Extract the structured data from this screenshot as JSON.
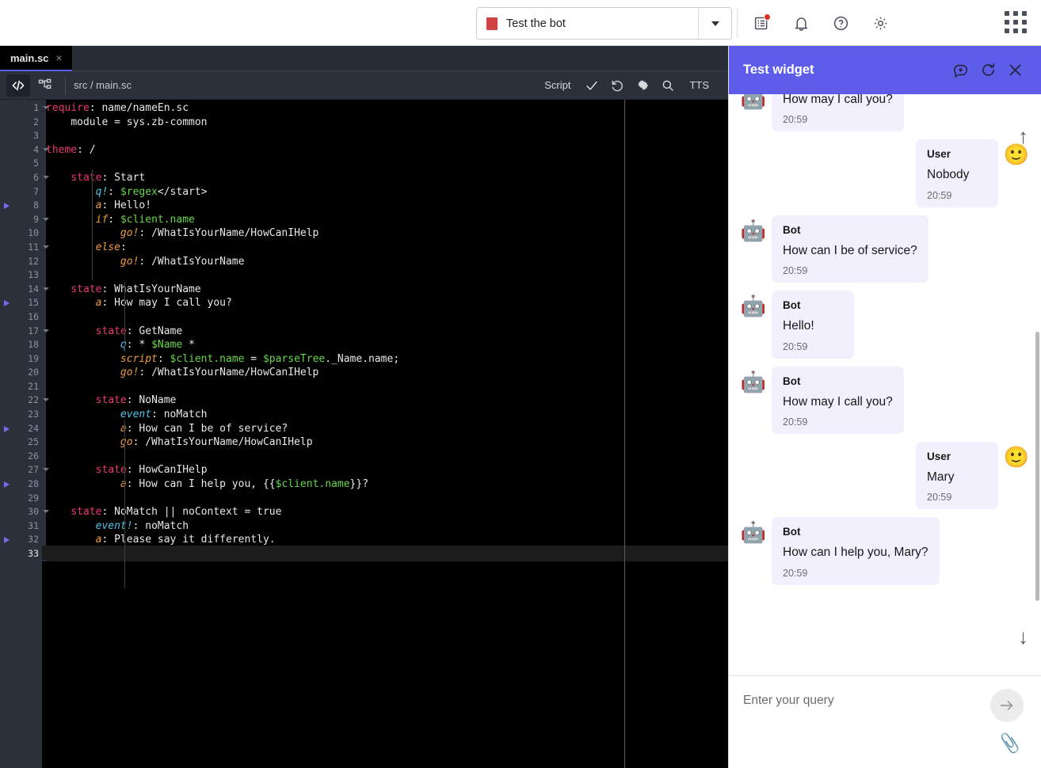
{
  "topbar": {
    "bot_selector": {
      "label": "Test the bot",
      "chip_color": "#cf4343",
      "caret": "chevron-down-icon"
    },
    "icons": [
      {
        "name": "release-notes-icon",
        "glyph": "notes",
        "badge": true
      },
      {
        "name": "notifications-bell-icon",
        "glyph": "bell",
        "badge": false
      },
      {
        "name": "help-icon",
        "glyph": "question",
        "badge": false
      },
      {
        "name": "settings-gear-icon",
        "glyph": "gear",
        "badge": false
      }
    ],
    "apps_label": "apps-grid-icon"
  },
  "editor": {
    "tab": {
      "label": "main.sc",
      "close": "×"
    },
    "toolbar": {
      "code_view_icon": "code-brackets-icon",
      "graph_view_icon": "flow-tree-icon",
      "path": "src / main.sc",
      "mode_label": "Script",
      "validate_icon": "checkmark-icon",
      "revert_icon": "undo-icon",
      "settings_icon": "gear-icon",
      "search_icon": "magnifier-icon",
      "tts_label": "TTS"
    },
    "accent": "#5d5df0",
    "lines": [
      {
        "n": 1,
        "fold": true,
        "bp": false,
        "tokens": [
          {
            "c": "t-kw",
            "t": "require"
          },
          {
            "c": "t-punc",
            "t": ": "
          },
          {
            "c": "t-str",
            "t": "name/nameEn.sc"
          }
        ]
      },
      {
        "n": 2,
        "fold": false,
        "bp": false,
        "tokens": [
          {
            "c": "t-punc",
            "t": "    "
          },
          {
            "c": "t-str",
            "t": "module = sys.zb-common"
          }
        ]
      },
      {
        "n": 3,
        "fold": false,
        "bp": false,
        "tokens": []
      },
      {
        "n": 4,
        "fold": true,
        "bp": false,
        "tokens": [
          {
            "c": "t-kw",
            "t": "theme"
          },
          {
            "c": "t-punc",
            "t": ": "
          },
          {
            "c": "t-str",
            "t": "/"
          }
        ]
      },
      {
        "n": 5,
        "fold": false,
        "bp": false,
        "tokens": []
      },
      {
        "n": 6,
        "fold": true,
        "bp": false,
        "tokens": [
          {
            "c": "t-punc",
            "t": "    "
          },
          {
            "c": "t-kw",
            "t": "state"
          },
          {
            "c": "t-punc",
            "t": ": "
          },
          {
            "c": "t-str",
            "t": "Start"
          }
        ]
      },
      {
        "n": 7,
        "fold": false,
        "bp": false,
        "tokens": [
          {
            "c": "t-punc",
            "t": "        "
          },
          {
            "c": "t-attr2",
            "t": "q!"
          },
          {
            "c": "t-punc",
            "t": ": "
          },
          {
            "c": "t-var",
            "t": "$regex"
          },
          {
            "c": "t-str",
            "t": "</start>"
          }
        ]
      },
      {
        "n": 8,
        "fold": false,
        "bp": true,
        "tokens": [
          {
            "c": "t-punc",
            "t": "        "
          },
          {
            "c": "t-attr",
            "t": "a"
          },
          {
            "c": "t-punc",
            "t": ": "
          },
          {
            "c": "t-str",
            "t": "Hello!"
          }
        ]
      },
      {
        "n": 9,
        "fold": true,
        "bp": false,
        "tokens": [
          {
            "c": "t-punc",
            "t": "        "
          },
          {
            "c": "t-attr",
            "t": "if"
          },
          {
            "c": "t-punc",
            "t": ": "
          },
          {
            "c": "t-var",
            "t": "$client.name"
          }
        ]
      },
      {
        "n": 10,
        "fold": false,
        "bp": false,
        "tokens": [
          {
            "c": "t-punc",
            "t": "            "
          },
          {
            "c": "t-attr",
            "t": "go!"
          },
          {
            "c": "t-punc",
            "t": ": "
          },
          {
            "c": "t-str",
            "t": "/WhatIsYourName/HowCanIHelp"
          }
        ]
      },
      {
        "n": 11,
        "fold": true,
        "bp": false,
        "tokens": [
          {
            "c": "t-punc",
            "t": "        "
          },
          {
            "c": "t-attr",
            "t": "else"
          },
          {
            "c": "t-punc",
            "t": ":"
          }
        ]
      },
      {
        "n": 12,
        "fold": false,
        "bp": false,
        "tokens": [
          {
            "c": "t-punc",
            "t": "            "
          },
          {
            "c": "t-attr",
            "t": "go!"
          },
          {
            "c": "t-punc",
            "t": ": "
          },
          {
            "c": "t-str",
            "t": "/WhatIsYourName"
          }
        ]
      },
      {
        "n": 13,
        "fold": false,
        "bp": false,
        "tokens": []
      },
      {
        "n": 14,
        "fold": true,
        "bp": false,
        "tokens": [
          {
            "c": "t-punc",
            "t": "    "
          },
          {
            "c": "t-kw",
            "t": "state"
          },
          {
            "c": "t-punc",
            "t": ": "
          },
          {
            "c": "t-str",
            "t": "WhatIsYourName"
          }
        ]
      },
      {
        "n": 15,
        "fold": false,
        "bp": true,
        "tokens": [
          {
            "c": "t-punc",
            "t": "        "
          },
          {
            "c": "t-attr",
            "t": "a"
          },
          {
            "c": "t-punc",
            "t": ": "
          },
          {
            "c": "t-str",
            "t": "How may I call you?"
          }
        ]
      },
      {
        "n": 16,
        "fold": false,
        "bp": false,
        "tokens": []
      },
      {
        "n": 17,
        "fold": true,
        "bp": false,
        "tokens": [
          {
            "c": "t-punc",
            "t": "        "
          },
          {
            "c": "t-kw",
            "t": "state"
          },
          {
            "c": "t-punc",
            "t": ": "
          },
          {
            "c": "t-str",
            "t": "GetName"
          }
        ]
      },
      {
        "n": 18,
        "fold": false,
        "bp": false,
        "tokens": [
          {
            "c": "t-punc",
            "t": "            "
          },
          {
            "c": "t-attr2",
            "t": "q"
          },
          {
            "c": "t-punc",
            "t": ": "
          },
          {
            "c": "t-str",
            "t": "* "
          },
          {
            "c": "t-var",
            "t": "$Name"
          },
          {
            "c": "t-str",
            "t": " *"
          }
        ]
      },
      {
        "n": 19,
        "fold": false,
        "bp": false,
        "tokens": [
          {
            "c": "t-punc",
            "t": "            "
          },
          {
            "c": "t-attr",
            "t": "script"
          },
          {
            "c": "t-punc",
            "t": ": "
          },
          {
            "c": "t-var",
            "t": "$client.name"
          },
          {
            "c": "t-op",
            "t": " = "
          },
          {
            "c": "t-var",
            "t": "$parseTree"
          },
          {
            "c": "t-str",
            "t": "._Name.name;"
          }
        ]
      },
      {
        "n": 20,
        "fold": false,
        "bp": false,
        "tokens": [
          {
            "c": "t-punc",
            "t": "            "
          },
          {
            "c": "t-attr",
            "t": "go!"
          },
          {
            "c": "t-punc",
            "t": ": "
          },
          {
            "c": "t-str",
            "t": "/WhatIsYourName/HowCanIHelp"
          }
        ]
      },
      {
        "n": 21,
        "fold": false,
        "bp": false,
        "tokens": []
      },
      {
        "n": 22,
        "fold": true,
        "bp": false,
        "tokens": [
          {
            "c": "t-punc",
            "t": "        "
          },
          {
            "c": "t-kw",
            "t": "state"
          },
          {
            "c": "t-punc",
            "t": ": "
          },
          {
            "c": "t-str",
            "t": "NoName"
          }
        ]
      },
      {
        "n": 23,
        "fold": false,
        "bp": false,
        "tokens": [
          {
            "c": "t-punc",
            "t": "            "
          },
          {
            "c": "t-attr2",
            "t": "event"
          },
          {
            "c": "t-punc",
            "t": ": "
          },
          {
            "c": "t-str",
            "t": "noMatch"
          }
        ]
      },
      {
        "n": 24,
        "fold": false,
        "bp": true,
        "tokens": [
          {
            "c": "t-punc",
            "t": "            "
          },
          {
            "c": "t-attr",
            "t": "a"
          },
          {
            "c": "t-punc",
            "t": ": "
          },
          {
            "c": "t-str",
            "t": "How can I be of service?"
          }
        ]
      },
      {
        "n": 25,
        "fold": false,
        "bp": false,
        "tokens": [
          {
            "c": "t-punc",
            "t": "            "
          },
          {
            "c": "t-attr",
            "t": "go"
          },
          {
            "c": "t-punc",
            "t": ": "
          },
          {
            "c": "t-str",
            "t": "/WhatIsYourName/HowCanIHelp"
          }
        ]
      },
      {
        "n": 26,
        "fold": false,
        "bp": false,
        "tokens": []
      },
      {
        "n": 27,
        "fold": true,
        "bp": false,
        "tokens": [
          {
            "c": "t-punc",
            "t": "        "
          },
          {
            "c": "t-kw",
            "t": "state"
          },
          {
            "c": "t-punc",
            "t": ": "
          },
          {
            "c": "t-str",
            "t": "HowCanIHelp"
          }
        ]
      },
      {
        "n": 28,
        "fold": false,
        "bp": true,
        "tokens": [
          {
            "c": "t-punc",
            "t": "            "
          },
          {
            "c": "t-attr",
            "t": "a"
          },
          {
            "c": "t-punc",
            "t": ": "
          },
          {
            "c": "t-str",
            "t": "How can I help you, "
          },
          {
            "c": "t-punc",
            "t": "{{"
          },
          {
            "c": "t-var",
            "t": "$client.name"
          },
          {
            "c": "t-punc",
            "t": "}}"
          },
          {
            "c": "t-str",
            "t": "?"
          }
        ]
      },
      {
        "n": 29,
        "fold": false,
        "bp": false,
        "tokens": []
      },
      {
        "n": 30,
        "fold": true,
        "bp": false,
        "tokens": [
          {
            "c": "t-punc",
            "t": "    "
          },
          {
            "c": "t-kw",
            "t": "state"
          },
          {
            "c": "t-punc",
            "t": ": "
          },
          {
            "c": "t-str",
            "t": "NoMatch "
          },
          {
            "c": "t-punc",
            "t": "|| "
          },
          {
            "c": "t-str",
            "t": "noContext = true"
          }
        ]
      },
      {
        "n": 31,
        "fold": false,
        "bp": false,
        "tokens": [
          {
            "c": "t-punc",
            "t": "        "
          },
          {
            "c": "t-attr2",
            "t": "event!"
          },
          {
            "c": "t-punc",
            "t": ": "
          },
          {
            "c": "t-str",
            "t": "noMatch"
          }
        ]
      },
      {
        "n": 32,
        "fold": false,
        "bp": true,
        "tokens": [
          {
            "c": "t-punc",
            "t": "        "
          },
          {
            "c": "t-attr",
            "t": "a"
          },
          {
            "c": "t-punc",
            "t": ": "
          },
          {
            "c": "t-str",
            "t": "Please say it differently."
          }
        ]
      },
      {
        "n": 33,
        "fold": false,
        "bp": false,
        "cur": true,
        "tokens": []
      }
    ]
  },
  "widget": {
    "title": "Test widget",
    "header_buttons": [
      {
        "name": "new-chat-icon"
      },
      {
        "name": "reload-icon"
      },
      {
        "name": "close-icon"
      }
    ],
    "accent": "#5d5dea",
    "scroll_up_icon": "arrow-up-icon",
    "scroll_down_icon": "arrow-down-icon",
    "messages": [
      {
        "side": "bot",
        "author": "",
        "text": "How may I call you?",
        "time": "20:59",
        "avatar": "🤖",
        "clipped": true
      },
      {
        "side": "user",
        "author": "User",
        "text": "Nobody",
        "time": "20:59",
        "avatar": "🙂"
      },
      {
        "side": "bot",
        "author": "Bot",
        "text": "How can I be of service?",
        "time": "20:59",
        "avatar": "🤖"
      },
      {
        "side": "bot",
        "author": "Bot",
        "text": "Hello!",
        "time": "20:59",
        "avatar": "🤖"
      },
      {
        "side": "bot",
        "author": "Bot",
        "text": "How may I call you?",
        "time": "20:59",
        "avatar": "🤖"
      },
      {
        "side": "user",
        "author": "User",
        "text": "Mary",
        "time": "20:59",
        "avatar": "🙂"
      },
      {
        "side": "bot",
        "author": "Bot",
        "text": "How can I help you, Mary?",
        "time": "20:59",
        "avatar": "🤖"
      }
    ],
    "input": {
      "placeholder": "Enter your query",
      "value": "",
      "send_icon": "arrow-right-icon",
      "attach_icon": "paperclip-icon"
    }
  }
}
